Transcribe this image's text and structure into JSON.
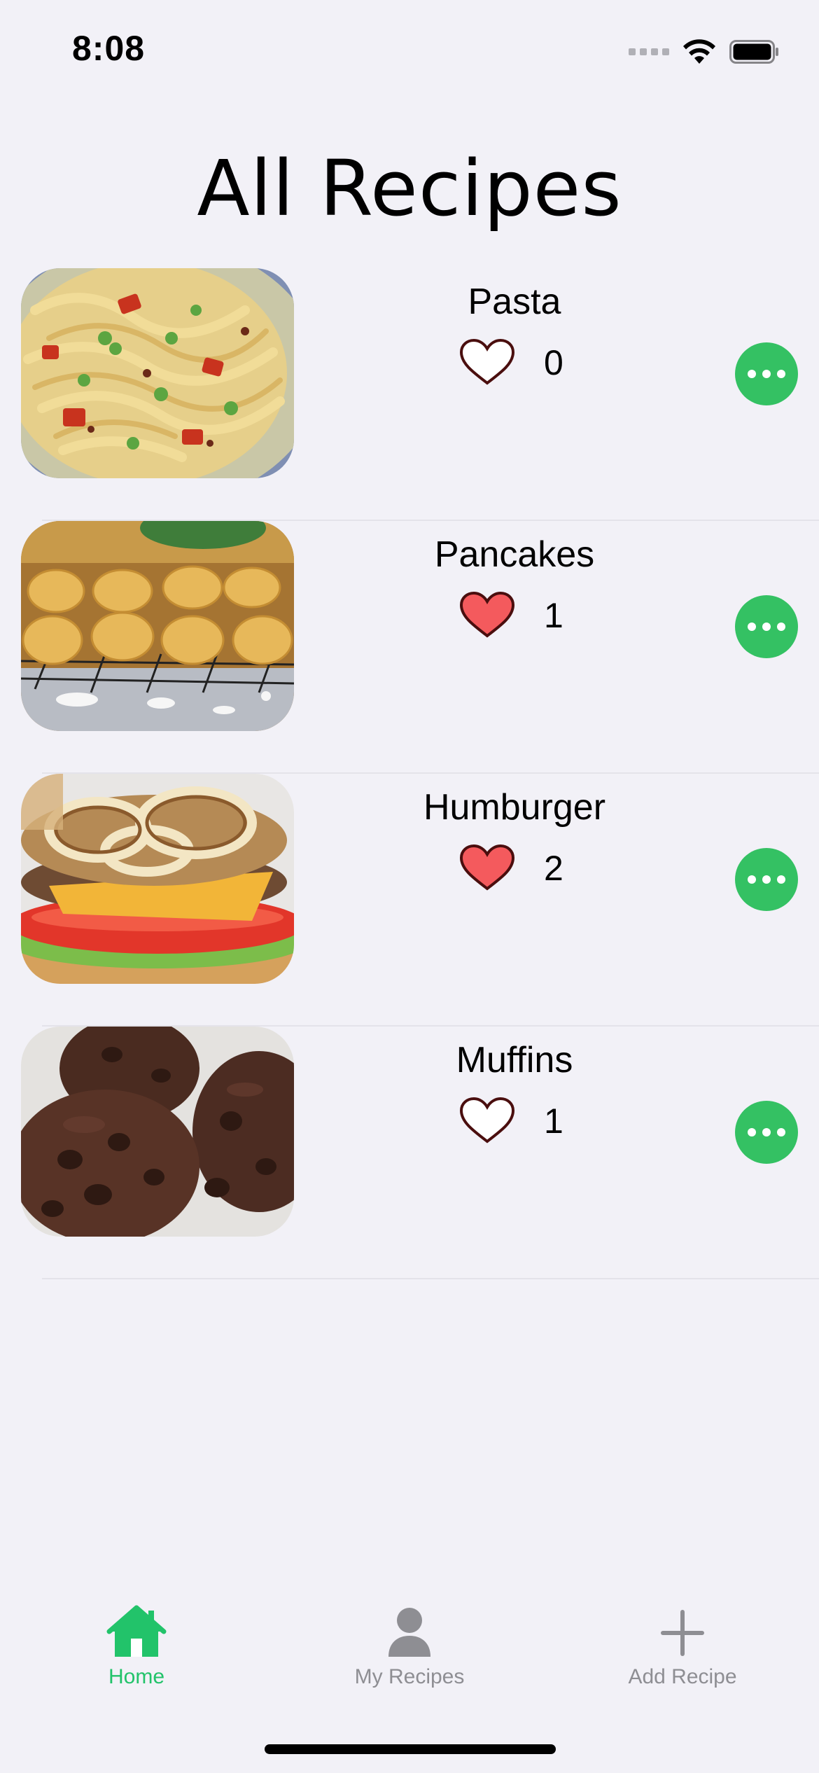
{
  "status_bar": {
    "time": "8:08"
  },
  "page": {
    "title": "All Recipes"
  },
  "recipes": [
    {
      "name": "Pasta",
      "likes": "0",
      "liked": false,
      "image": "pasta-photo"
    },
    {
      "name": "Pancakes",
      "likes": "1",
      "liked": true,
      "image": "pancakes-photo"
    },
    {
      "name": "Humburger",
      "likes": "2",
      "liked": true,
      "image": "hamburger-photo"
    },
    {
      "name": "Muffins",
      "likes": "1",
      "liked": false,
      "image": "muffins-photo"
    }
  ],
  "tab_bar": {
    "items": [
      {
        "label": "Home",
        "icon": "house-icon",
        "active": true
      },
      {
        "label": "My Recipes",
        "icon": "person-icon",
        "active": false
      },
      {
        "label": "Add Recipe",
        "icon": "plus-icon",
        "active": false
      }
    ]
  },
  "colors": {
    "background": "#f2f1f7",
    "accent_green": "#34c163",
    "tab_active": "#22c36a",
    "tab_inactive": "#8e8e93",
    "heart_filled": "#f45a5d",
    "heart_outline": "#4a0e0e"
  }
}
